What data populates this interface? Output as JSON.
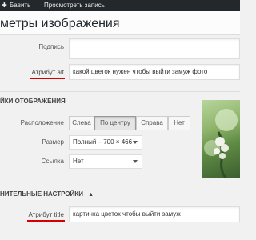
{
  "topbar": {
    "item1": "Бавить",
    "item2": "Просмотреть запись"
  },
  "header": {
    "title": "метры изображения"
  },
  "caption": {
    "label": "Подпись",
    "value": ""
  },
  "alt": {
    "label": "Атрибут alt",
    "value": "какой цветок нужен чтобы выйти замуж фото"
  },
  "display_section": {
    "title": "ЙКИ ОТОБРАЖЕНИЯ"
  },
  "align": {
    "label": "Расположение",
    "options": [
      "Слева",
      "По центру",
      "Справа",
      "Нет"
    ],
    "selected": "По центру"
  },
  "size": {
    "label": "Размер",
    "value": "Полный – 700 × 466"
  },
  "link": {
    "label": "Ссылка",
    "value": "Нет"
  },
  "advanced_section": {
    "title": "НИТЕЛЬНЫЕ НАСТРОЙКИ",
    "arrow": "▲"
  },
  "title_attr": {
    "label": "Атрибут title",
    "value": "картинка цветок чтобы выйти замуж"
  },
  "colors": {
    "accent_red": "#d60000",
    "active_button": "#e5e5e5"
  }
}
